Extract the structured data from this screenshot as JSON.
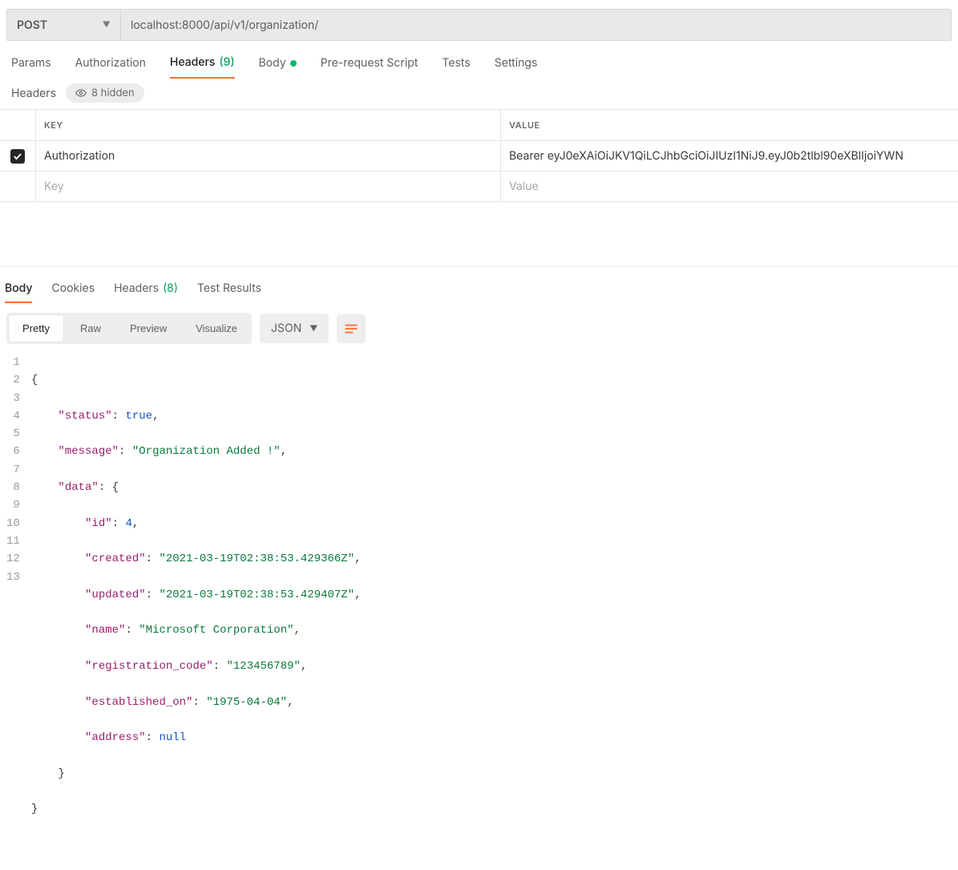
{
  "request": {
    "method": "POST",
    "url": "localhost:8000/api/v1/organization/",
    "tabs": {
      "params": "Params",
      "auth": "Authorization",
      "headers": "Headers",
      "headers_count": "(9)",
      "body": "Body",
      "prereq": "Pre-request Script",
      "tests": "Tests",
      "settings": "Settings"
    }
  },
  "headers_section": {
    "title": "Headers",
    "hidden_label": "8 hidden",
    "cols": {
      "key": "KEY",
      "value": "VALUE"
    },
    "rows": [
      {
        "checked": true,
        "key": "Authorization",
        "value": "Bearer eyJ0eXAiOiJKV1QiLCJhbGciOiJIUzI1NiJ9.eyJ0b2tlbl90eXBlIjoiYWN"
      }
    ],
    "placeholders": {
      "key": "Key",
      "value": "Value"
    }
  },
  "response": {
    "tabs": {
      "body": "Body",
      "cookies": "Cookies",
      "headers": "Headers",
      "headers_count": "(8)",
      "test_results": "Test Results"
    },
    "views": {
      "pretty": "Pretty",
      "raw": "Raw",
      "preview": "Preview",
      "visualize": "Visualize"
    },
    "format": "JSON",
    "line_numbers": [
      "1",
      "2",
      "3",
      "4",
      "5",
      "6",
      "7",
      "8",
      "9",
      "10",
      "11",
      "12",
      "13"
    ],
    "json": {
      "l1": "{",
      "l2a": "\"status\"",
      "l2b": ": ",
      "l2c": "true",
      "l2d": ",",
      "l3a": "\"message\"",
      "l3b": ": ",
      "l3c": "\"Organization Added !\"",
      "l3d": ",",
      "l4a": "\"data\"",
      "l4b": ": {",
      "l5a": "\"id\"",
      "l5b": ": ",
      "l5c": "4",
      "l5d": ",",
      "l6a": "\"created\"",
      "l6b": ": ",
      "l6c": "\"2021-03-19T02:38:53.429366Z\"",
      "l6d": ",",
      "l7a": "\"updated\"",
      "l7b": ": ",
      "l7c": "\"2021-03-19T02:38:53.429407Z\"",
      "l7d": ",",
      "l8a": "\"name\"",
      "l8b": ": ",
      "l8c": "\"Microsoft Corporation\"",
      "l8d": ",",
      "l9a": "\"registration_code\"",
      "l9b": ": ",
      "l9c": "\"123456789\"",
      "l9d": ",",
      "l10a": "\"established_on\"",
      "l10b": ": ",
      "l10c": "\"1975-04-04\"",
      "l10d": ",",
      "l11a": "\"address\"",
      "l11b": ": ",
      "l11c": "null",
      "l12": "    }",
      "l13": "}"
    }
  }
}
